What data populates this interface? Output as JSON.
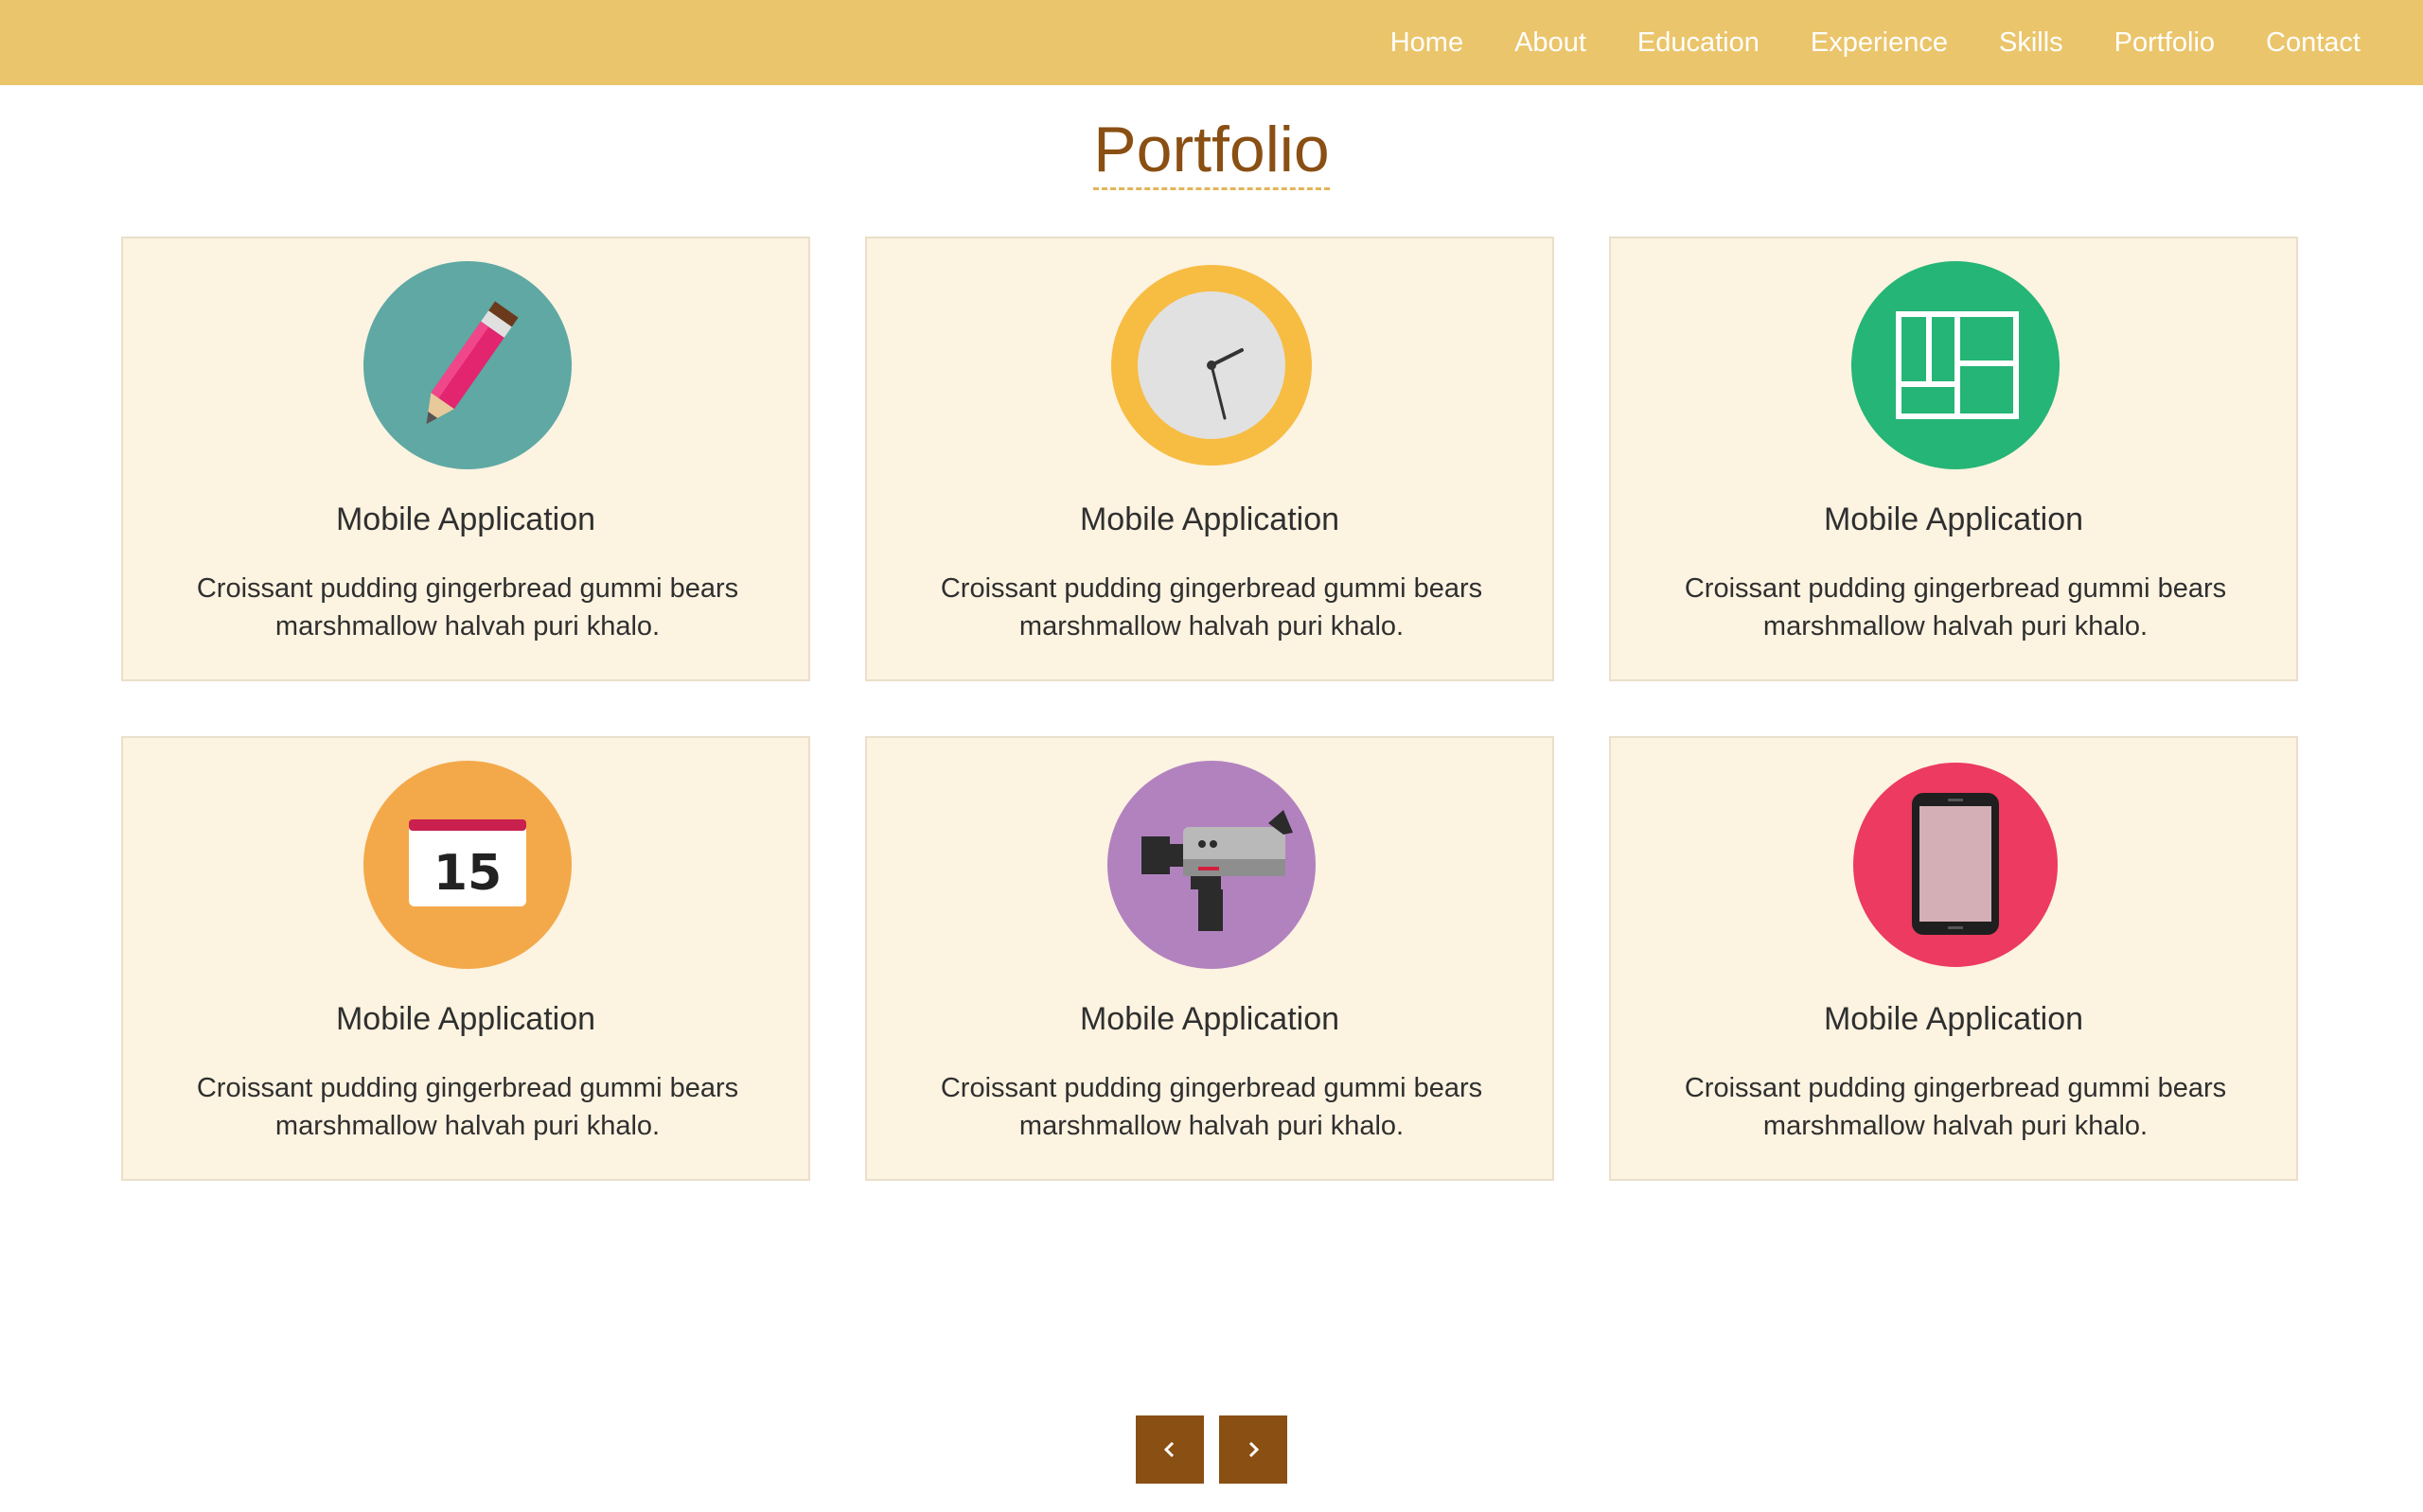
{
  "nav": {
    "items": [
      {
        "label": "Home"
      },
      {
        "label": "About"
      },
      {
        "label": "Education"
      },
      {
        "label": "Experience"
      },
      {
        "label": "Skills"
      },
      {
        "label": "Portfolio"
      },
      {
        "label": "Contact"
      }
    ]
  },
  "portfolio": {
    "title": "Portfolio",
    "cards": [
      {
        "icon": "pencil-icon",
        "title": "Mobile Application",
        "description": "Croissant pudding gingerbread gummi bears marshmallow halvah puri khalo."
      },
      {
        "icon": "clock-icon",
        "title": "Mobile Application",
        "description": "Croissant pudding gingerbread gummi bears marshmallow halvah puri khalo."
      },
      {
        "icon": "layout-icon",
        "title": "Mobile Application",
        "description": "Croissant pudding gingerbread gummi bears marshmallow halvah puri khalo."
      },
      {
        "icon": "calendar-icon",
        "title": "Mobile Application",
        "description": "Croissant pudding gingerbread gummi bears marshmallow halvah puri khalo.",
        "date": "15"
      },
      {
        "icon": "video-camera-icon",
        "title": "Mobile Application",
        "description": "Croissant pudding gingerbread gummi bears marshmallow halvah puri khalo."
      },
      {
        "icon": "smartphone-icon",
        "title": "Mobile Application",
        "description": "Croissant pudding gingerbread gummi bears marshmallow halvah puri khalo."
      }
    ]
  },
  "pagination": {
    "prev_icon": "chevron-left-icon",
    "next_icon": "chevron-right-icon"
  },
  "colors": {
    "navbar": "#ebc56b",
    "accent": "#8a4f13",
    "card_bg": "#fcf3e1"
  }
}
